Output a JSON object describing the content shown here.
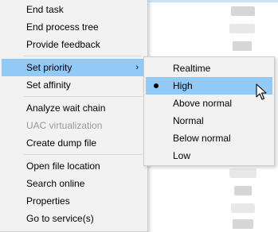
{
  "main_menu": {
    "items": [
      {
        "label": "End task",
        "enabled": true
      },
      {
        "label": "End process tree",
        "enabled": true
      },
      {
        "label": "Provide feedback",
        "enabled": true
      },
      {
        "label": "Set priority",
        "enabled": true,
        "has_submenu": true
      },
      {
        "label": "Set affinity",
        "enabled": true
      },
      {
        "label": "Analyze wait chain",
        "enabled": true
      },
      {
        "label": "UAC virtualization",
        "enabled": false
      },
      {
        "label": "Create dump file",
        "enabled": true
      },
      {
        "label": "Open file location",
        "enabled": true
      },
      {
        "label": "Search online",
        "enabled": true
      },
      {
        "label": "Properties",
        "enabled": true
      },
      {
        "label": "Go to service(s)",
        "enabled": true
      }
    ],
    "submenu_chevron": "›"
  },
  "priority_submenu": {
    "items": [
      {
        "label": "Realtime"
      },
      {
        "label": "High",
        "selected": true,
        "hovered": true
      },
      {
        "label": "Above normal"
      },
      {
        "label": "Normal"
      },
      {
        "label": "Below normal"
      },
      {
        "label": "Low"
      }
    ]
  },
  "colors": {
    "menu_bg": "#f2f2f2",
    "highlight": "#91c9f7",
    "disabled_text": "#9a9a9a"
  }
}
